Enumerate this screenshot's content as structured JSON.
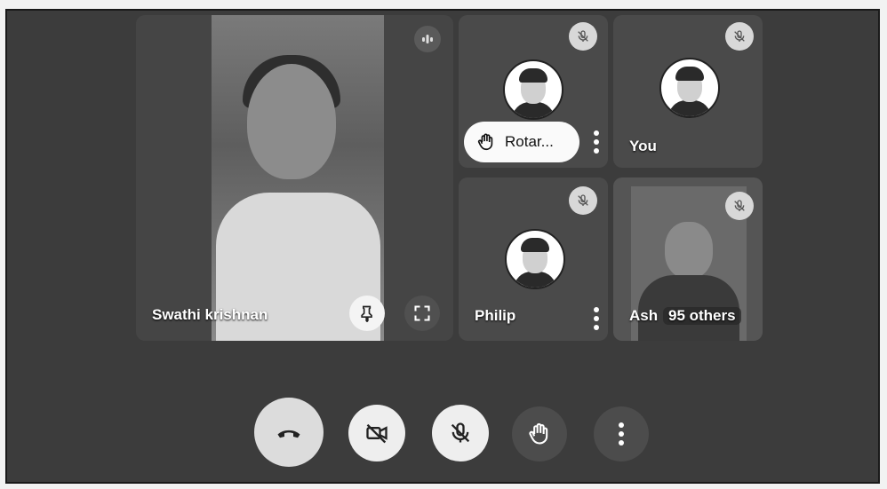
{
  "participants": {
    "main": {
      "name": "Swathi krishnan"
    },
    "tile_rotary": {
      "hand_label": "Rotar..."
    },
    "tile_you": {
      "name": "You"
    },
    "tile_philip": {
      "name": "Philip"
    },
    "tile_others": {
      "name_partial": "Ash",
      "others_label": "95 others"
    }
  },
  "icons": {
    "pin": "pin-icon",
    "fullscreen": "fullscreen-icon",
    "audio": "audio-levels-icon",
    "mic_off": "mic-off-icon",
    "hand": "raise-hand-icon",
    "more": "more-vert-icon",
    "hangup": "hang-up-icon",
    "camera_off": "camera-off-icon"
  }
}
